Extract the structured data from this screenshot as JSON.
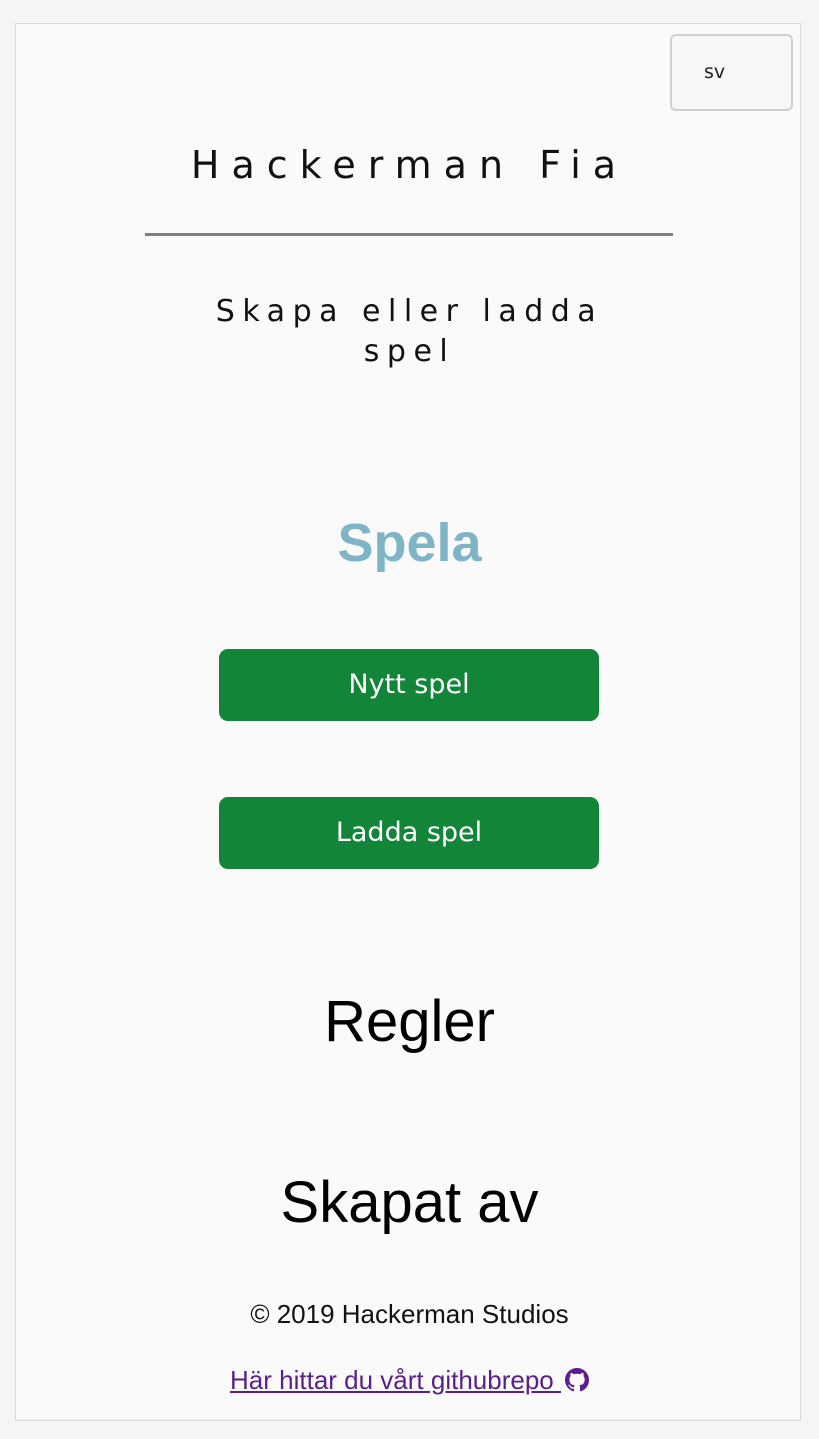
{
  "language_selector": {
    "value": "sv"
  },
  "header": {
    "title": "Hackerman Fia",
    "subtitle": "Skapa eller ladda spel"
  },
  "play": {
    "heading": "Spela",
    "new_game_label": "Nytt spel",
    "load_game_label": "Ladda spel"
  },
  "rules": {
    "heading": "Regler"
  },
  "credits": {
    "heading": "Skapat av",
    "copyright": "© 2019 Hackerman Studios",
    "repo_link_text": "Här hittar du vårt githubrepo "
  },
  "icons": {
    "repo_icon": "github-icon"
  },
  "colors": {
    "button_green": "#138539",
    "spela_blue": "#7fb4c6",
    "link_purple": "#5a1f8a",
    "divider_gray": "#7f7f7f"
  }
}
